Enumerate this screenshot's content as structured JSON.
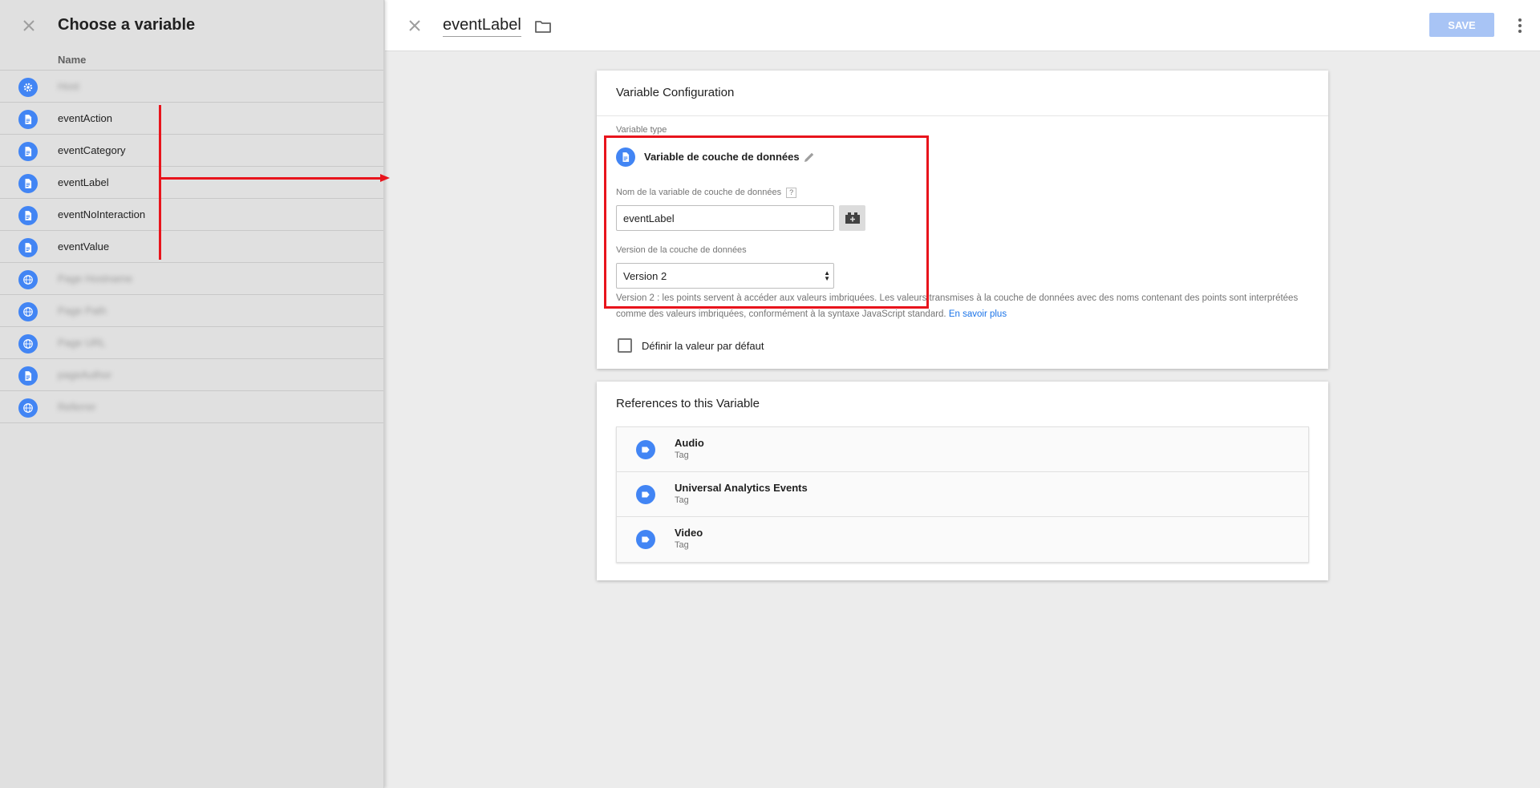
{
  "left_panel": {
    "title": "Choose a variable",
    "column_header": "Name",
    "variables": [
      {
        "name": "Host",
        "icon": "gear-icon",
        "blurred": true
      },
      {
        "name": "eventAction",
        "icon": "document-icon",
        "blurred": false
      },
      {
        "name": "eventCategory",
        "icon": "document-icon",
        "blurred": false
      },
      {
        "name": "eventLabel",
        "icon": "document-icon",
        "blurred": false
      },
      {
        "name": "eventNoInteraction",
        "icon": "document-icon",
        "blurred": false
      },
      {
        "name": "eventValue",
        "icon": "document-icon",
        "blurred": false
      },
      {
        "name": "Page Hostname",
        "icon": "globe-icon",
        "blurred": true
      },
      {
        "name": "Page Path",
        "icon": "globe-icon",
        "blurred": true
      },
      {
        "name": "Page URL",
        "icon": "globe-icon",
        "blurred": true
      },
      {
        "name": "pageAuthor",
        "icon": "document-icon",
        "blurred": true
      },
      {
        "name": "Referrer",
        "icon": "globe-icon",
        "blurred": true
      }
    ]
  },
  "header": {
    "variable_title": "eventLabel",
    "save_label": "SAVE"
  },
  "config": {
    "card_title": "Variable Configuration",
    "type_label": "Variable type",
    "type_name": "Variable de couche de données",
    "name_label": "Nom de la variable de couche de données",
    "help_badge": "?",
    "name_value": "eventLabel",
    "version_label": "Version de la couche de données",
    "version_value": "Version 2",
    "help_text": "Version 2 : les points servent à accéder aux valeurs imbriquées. Les valeurs transmises à la couche de données avec des noms contenant des points sont interprétées comme des valeurs imbriquées, conformément à la syntaxe JavaScript standard.",
    "learn_more": "En savoir plus",
    "default_checkbox_label": "Définir la valeur par défaut"
  },
  "references": {
    "card_title": "References to this Variable",
    "items": [
      {
        "name": "Audio",
        "type": "Tag"
      },
      {
        "name": "Universal Analytics Events",
        "type": "Tag"
      },
      {
        "name": "Video",
        "type": "Tag"
      }
    ]
  },
  "colors": {
    "accent": "#4285f4",
    "save_disabled": "#a8c4f5",
    "annotation": "#e8141c",
    "link": "#1a73e8"
  }
}
